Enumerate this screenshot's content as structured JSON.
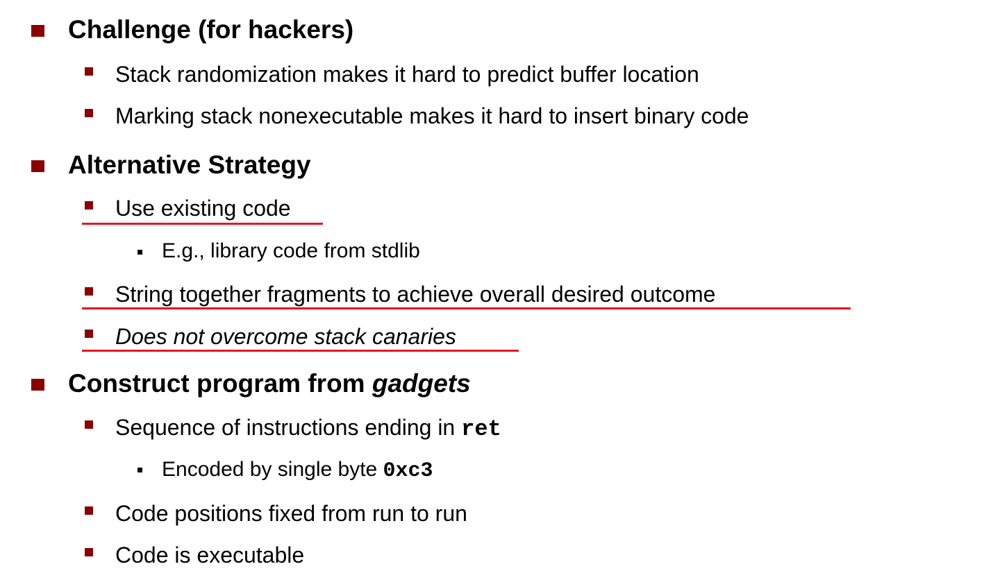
{
  "bullets": {
    "challenge": {
      "title": "Challenge (for hackers)",
      "items": [
        "Stack randomization makes it hard to predict buffer location",
        "Marking stack nonexecutable makes it hard to insert binary code"
      ]
    },
    "alternative": {
      "title": "Alternative Strategy",
      "use_existing": "Use existing code",
      "use_existing_sub": "E.g., library code from stdlib",
      "string_together": "String together fragments to achieve overall desired outcome",
      "canaries": "Does not overcome stack canaries"
    },
    "construct": {
      "title_prefix": "Construct program from ",
      "title_em": "gadgets",
      "sequence_prefix": "Sequence of instructions ending in ",
      "sequence_code": "ret",
      "encoded_prefix": "Encoded by single byte ",
      "encoded_code": "0xc3",
      "positions": "Code positions fixed from run to run",
      "executable": "Code is executable"
    }
  },
  "colors": {
    "bullet": "#8b0000",
    "underline": "#e8161b"
  }
}
